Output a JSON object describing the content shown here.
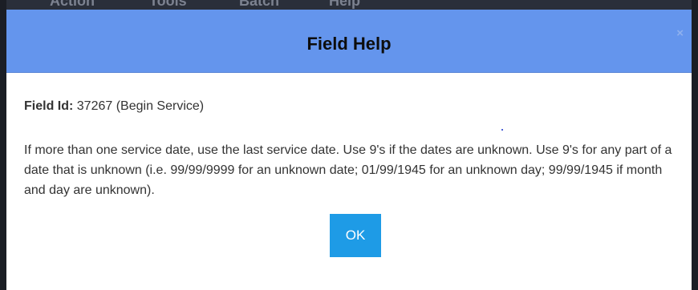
{
  "background_menu": {
    "items": [
      "Action",
      "Tools",
      "Batch",
      "Help"
    ]
  },
  "dialog": {
    "title": "Field Help",
    "close_label": "×",
    "field_id_label": "Field Id:",
    "field_id_value": "37267 (Begin Service)",
    "help_text": "If more than one service date, use the last service date. Use 9's if the dates are unknown. Use 9's for any part of a date that is unknown (i.e. 99/99/9999 for an unknown date; 01/99/1945 for an unknown day; 99/99/1945 if month and day are unknown).",
    "ok_label": "OK"
  },
  "colors": {
    "header_bg": "#6495ed",
    "ok_button_bg": "#1e9be6",
    "body_text": "#333333"
  }
}
